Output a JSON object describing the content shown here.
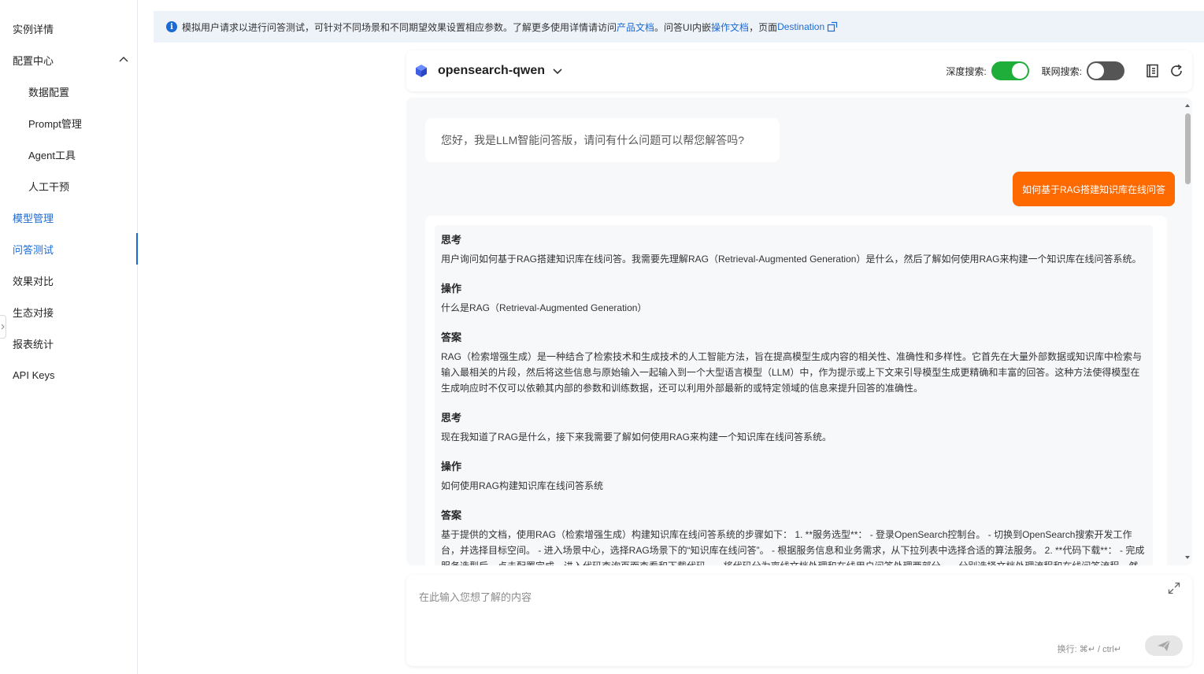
{
  "sidebar": {
    "items": [
      {
        "label": "实例详情"
      },
      {
        "label": "配置中心"
      },
      {
        "label": "数据配置"
      },
      {
        "label": "Prompt管理"
      },
      {
        "label": "Agent工具"
      },
      {
        "label": "人工干预"
      },
      {
        "label": "模型管理"
      },
      {
        "label": "问答测试"
      },
      {
        "label": "效果对比"
      },
      {
        "label": "生态对接"
      },
      {
        "label": "报表统计"
      },
      {
        "label": "API Keys"
      }
    ]
  },
  "banner": {
    "text1": "模拟用户请求以进行问答测试，可针对不同场景和不同期望效果设置相应参数。了解更多使用详情请访问 ",
    "link1": "产品文档",
    "text2": "。问答UI内嵌",
    "link2": "操作文档",
    "text3": "，页面",
    "link3": "Destination"
  },
  "header": {
    "model_name": "opensearch-qwen",
    "deep_search_label": "深度搜索:",
    "deep_search_on": true,
    "web_search_label": "联网搜索:",
    "web_search_on": false
  },
  "chat": {
    "greeting": "您好，我是LLM智能问答版，请问有什么问题可以帮您解答吗?",
    "user_message": "如何基于RAG搭建知识库在线问答",
    "sections": [
      {
        "title": "思考",
        "body": "用户询问如何基于RAG搭建知识库在线问答。我需要先理解RAG（Retrieval-Augmented Generation）是什么，然后了解如何使用RAG来构建一个知识库在线问答系统。"
      },
      {
        "title": "操作",
        "body": "什么是RAG（Retrieval-Augmented Generation）"
      },
      {
        "title": "答案",
        "body": "RAG（检索增强生成）是一种结合了检索技术和生成技术的人工智能方法，旨在提高模型生成内容的相关性、准确性和多样性。它首先在大量外部数据或知识库中检索与输入最相关的片段，然后将这些信息与原始输入一起输入到一个大型语言模型（LLM）中，作为提示或上下文来引导模型生成更精确和丰富的回答。这种方法使得模型在生成响应时不仅可以依赖其内部的参数和训练数据，还可以利用外部最新的或特定领域的信息来提升回答的准确性。"
      },
      {
        "title": "思考",
        "body": "现在我知道了RAG是什么，接下来我需要了解如何使用RAG来构建一个知识库在线问答系统。"
      },
      {
        "title": "操作",
        "body": "如何使用RAG构建知识库在线问答系统"
      },
      {
        "title": "答案",
        "body": "基于提供的文档，使用RAG（检索增强生成）构建知识库在线问答系统的步骤如下： 1. **服务选型**： - 登录OpenSearch控制台。 - 切换到OpenSearch搜索开发工作台，并选择目标空间。 - 进入场景中心，选择RAG场景下的“知识库在线问答”。 - 根据服务信息和业务需求，从下拉列表中选择合适的算法服务。 2. **代码下载**： - 完成服务选型后，点击配置完成，进入代码查询页面查看和下载代码。 - 将代码分为离线文档处理和在线用户问答处理两部分， - 分别选择文档处理流程和在线问答流程，然后复"
      }
    ]
  },
  "input": {
    "placeholder": "在此输入您想了解的内容",
    "hint": "换行: ⌘↵ / ctrl↵"
  }
}
